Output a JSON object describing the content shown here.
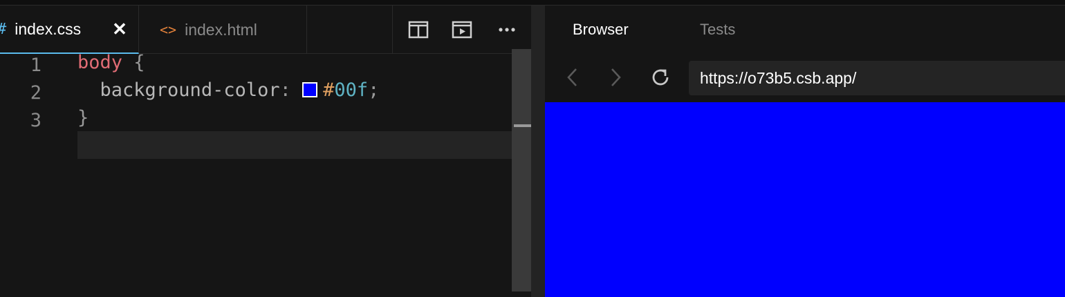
{
  "editor": {
    "tabs": [
      {
        "icon": "#",
        "label": "index.css",
        "active": true
      },
      {
        "icon": "<>",
        "label": "index.html",
        "active": false
      }
    ],
    "close_glyph": "✕",
    "line_numbers": [
      "1",
      "2",
      "3"
    ],
    "code": {
      "line1": {
        "selector": "body",
        "brace_open": " {"
      },
      "line2": {
        "indent": "  ",
        "property": "background-color",
        "colon": ": ",
        "hash": "#",
        "value": "00f",
        "semicolon": ";"
      },
      "line3": {
        "brace_close": "}"
      }
    },
    "swatch_color": "#0000ff"
  },
  "preview": {
    "tabs": [
      {
        "label": "Browser",
        "active": true
      },
      {
        "label": "Tests",
        "active": false
      }
    ],
    "url": "https://o73b5.csb.app/",
    "viewport_color": "#0000ff"
  },
  "colors": {
    "accent": "#5bbcee",
    "html_icon": "#e0803a"
  }
}
